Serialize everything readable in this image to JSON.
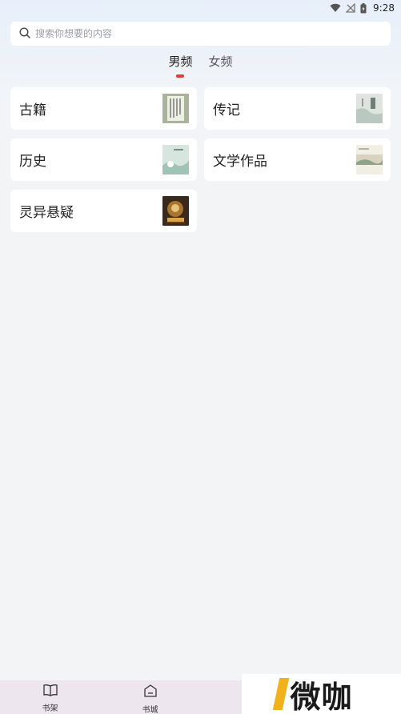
{
  "status_bar": {
    "time": "9:28"
  },
  "search": {
    "placeholder": "搜索你想要的内容"
  },
  "tabs": [
    {
      "label": "男频",
      "active": true
    },
    {
      "label": "女频",
      "active": false
    }
  ],
  "categories": [
    {
      "label": "古籍"
    },
    {
      "label": "传记"
    },
    {
      "label": "历史"
    },
    {
      "label": "文学作品"
    },
    {
      "label": "灵异悬疑"
    }
  ],
  "bottom_nav": [
    {
      "label": "书架",
      "icon": "book-icon"
    },
    {
      "label": "书城",
      "icon": "store-icon"
    }
  ],
  "watermark": {
    "text": "微咖"
  },
  "colors": {
    "accent": "#e53b3b",
    "nav_bg": "#ede6ef",
    "watermark_slash": "#f0b11b"
  }
}
